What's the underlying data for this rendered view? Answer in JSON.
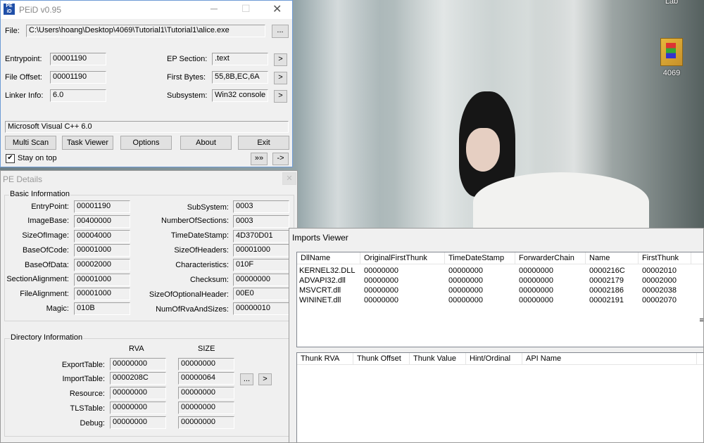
{
  "desktop": {
    "icons": [
      {
        "label": "Lab"
      },
      {
        "label": "4069"
      }
    ]
  },
  "peid": {
    "title": "PEiD v0.95",
    "file_label": "File:",
    "file_path": "C:\\Users\\hoang\\Desktop\\4069\\Tutorial1\\Tutorial1\\alice.exe",
    "browse_label": "...",
    "entrypoint_label": "Entrypoint:",
    "entrypoint": "00001190",
    "fileoffset_label": "File Offset:",
    "fileoffset": "00001190",
    "linker_label": "Linker Info:",
    "linker": "6.0",
    "epsection_label": "EP Section:",
    "epsection": ".text",
    "firstbytes_label": "First Bytes:",
    "firstbytes": "55,8B,EC,6A",
    "subsystem_label": "Subsystem:",
    "subsystem": "Win32 console",
    "arrow": ">",
    "detection": "Microsoft Visual C++ 6.0",
    "buttons": {
      "multiscan": "Multi Scan",
      "taskviewer": "Task Viewer",
      "options": "Options",
      "about": "About",
      "exit": "Exit",
      "more": "»»",
      "go": "->"
    },
    "stay_on_top": "Stay on top"
  },
  "pe_details": {
    "title": "PE Details",
    "basic_title": "Basic Information",
    "left": [
      {
        "label": "EntryPoint:",
        "value": "00001190"
      },
      {
        "label": "ImageBase:",
        "value": "00400000"
      },
      {
        "label": "SizeOfImage:",
        "value": "00004000"
      },
      {
        "label": "BaseOfCode:",
        "value": "00001000"
      },
      {
        "label": "BaseOfData:",
        "value": "00002000"
      },
      {
        "label": "SectionAlignment:",
        "value": "00001000"
      },
      {
        "label": "FileAlignment:",
        "value": "00001000"
      },
      {
        "label": "Magic:",
        "value": "010B"
      }
    ],
    "right": [
      {
        "label": "SubSystem:",
        "value": "0003"
      },
      {
        "label": "NumberOfSections:",
        "value": "0003"
      },
      {
        "label": "TimeDateStamp:",
        "value": "4D370D01"
      },
      {
        "label": "SizeOfHeaders:",
        "value": "00001000"
      },
      {
        "label": "Characteristics:",
        "value": "010F"
      },
      {
        "label": "Checksum:",
        "value": "00000000"
      },
      {
        "label": "SizeOfOptionalHeader:",
        "value": "00E0"
      },
      {
        "label": "NumOfRvaAndSizes:",
        "value": "00000010"
      }
    ],
    "dir_title": "Directory Information",
    "rva_header": "RVA",
    "size_header": "SIZE",
    "dirs": [
      {
        "label": "ExportTable:",
        "rva": "00000000",
        "size": "00000000"
      },
      {
        "label": "ImportTable:",
        "rva": "0000208C",
        "size": "00000064"
      },
      {
        "label": "Resource:",
        "rva": "00000000",
        "size": "00000000"
      },
      {
        "label": "TLSTable:",
        "rva": "00000000",
        "size": "00000000"
      },
      {
        "label": "Debug:",
        "rva": "00000000",
        "size": "00000000"
      }
    ],
    "dots": "...",
    "arrow": ">"
  },
  "imports": {
    "title": "Imports Viewer",
    "columns": [
      "DllName",
      "OriginalFirstThunk",
      "TimeDateStamp",
      "ForwarderChain",
      "Name",
      "FirstThunk"
    ],
    "rows": [
      [
        "KERNEL32.DLL",
        "00000000",
        "00000000",
        "00000000",
        "0000216C",
        "00002010"
      ],
      [
        "ADVAPI32.dll",
        "00000000",
        "00000000",
        "00000000",
        "00002179",
        "00002000"
      ],
      [
        "MSVCRT.dll",
        "00000000",
        "00000000",
        "00000000",
        "00002186",
        "00002038"
      ],
      [
        "WININET.dll",
        "00000000",
        "00000000",
        "00000000",
        "00002191",
        "00002070"
      ]
    ],
    "thunk_columns": [
      "Thunk RVA",
      "Thunk Offset",
      "Thunk Value",
      "Hint/Ordinal",
      "API Name"
    ]
  }
}
